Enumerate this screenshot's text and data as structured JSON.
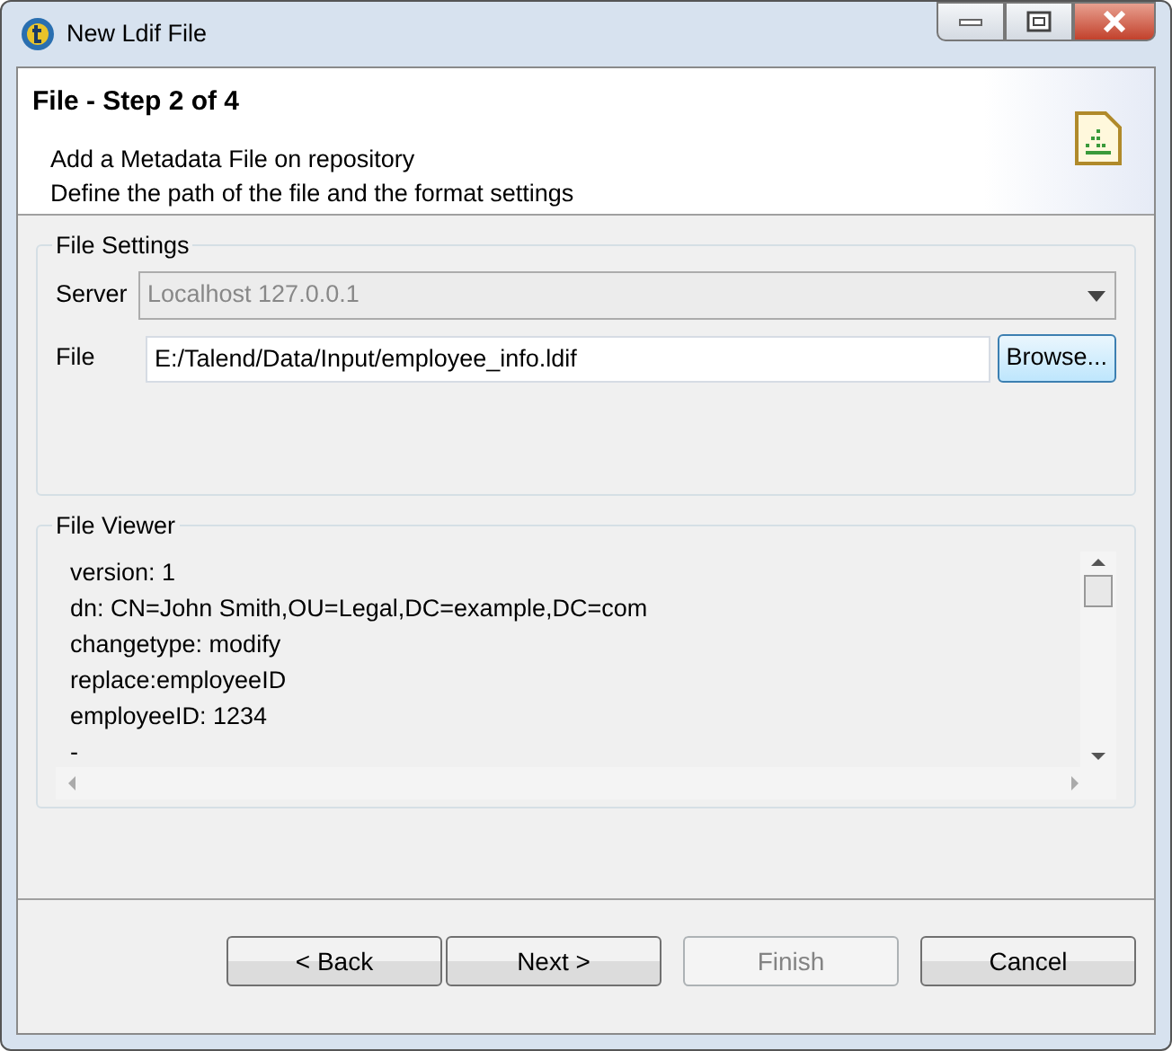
{
  "window": {
    "title": "New Ldif File"
  },
  "header": {
    "title": "File - Step 2 of 4",
    "lines": [
      "Add a Metadata File on repository",
      "Define the path of the file and the format settings"
    ]
  },
  "file_settings": {
    "title": "File Settings",
    "server": {
      "label": "Server",
      "value": "Localhost 127.0.0.1",
      "disabled": true
    },
    "file": {
      "label": "File",
      "value": "E:/Talend/Data/Input/employee_info.ldif"
    },
    "browse": "Browse..."
  },
  "file_viewer": {
    "title": "File Viewer",
    "lines": [
      "version: 1",
      "dn: CN=John Smith,OU=Legal,DC=example,DC=com",
      "changetype: modify",
      "replace:employeeID",
      "employeeID: 1234",
      "-"
    ]
  },
  "buttons": [
    {
      "label": "< Back",
      "disabled": false
    },
    {
      "label": "Next >",
      "disabled": false
    },
    {
      "label": "Finish",
      "disabled": true
    },
    {
      "label": "Cancel",
      "disabled": false
    }
  ]
}
